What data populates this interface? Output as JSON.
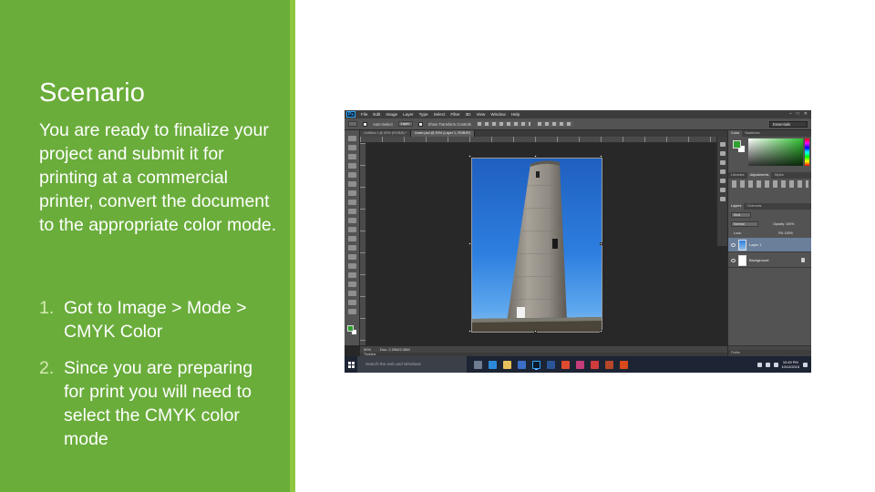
{
  "slide": {
    "title": "Scenario",
    "intro": "You are ready to finalize your project and submit it for printing at a commercial printer, convert the document to the appropriate color mode.",
    "steps": [
      {
        "number": "1.",
        "text": "Got to Image > Mode > CMYK Color"
      },
      {
        "number": "2.",
        "text": "Since you are preparing for print you will need to select the CMYK color mode"
      }
    ]
  },
  "colors": {
    "panel_green": "#6aad3b",
    "panel_edge": "#8dc63f",
    "number_color": "#d4ecb2"
  },
  "photoshop": {
    "logo": "Ps",
    "menus": [
      "File",
      "Edit",
      "Image",
      "Layer",
      "Type",
      "Select",
      "Filter",
      "3D",
      "View",
      "Window",
      "Help"
    ],
    "options": {
      "auto_select": "Auto-Select",
      "auto_select_target": "Layer",
      "show_transform": "Show Transform Controls",
      "workspace": "Essentials"
    },
    "doc_tabs": [
      {
        "label": "Untitled-1 @ 50% (RGB/8) *",
        "active": false
      },
      {
        "label": "tower.psd @ 50% (Layer 1, RGB/8*)",
        "active": true
      }
    ],
    "status": {
      "zoom": "50%",
      "doc_size": "Doc: 2.29M/2.08M"
    },
    "timeline": "Timeline",
    "panels": {
      "color_tabs": [
        "Color",
        "Swatches"
      ],
      "adjust_tabs": [
        "Libraries",
        "Adjustments",
        "Styles"
      ],
      "layers_tabs": [
        "Layers",
        "Channels"
      ],
      "kind": "Kind",
      "blend": "Normal",
      "opacity": "Opacity: 100%",
      "lock": "Lock:",
      "fill": "Fill: 100%",
      "layers": [
        {
          "name": "Layer 1",
          "selected": true
        },
        {
          "name": "Background",
          "selected": false
        }
      ],
      "paths_label": "Paths"
    },
    "taskbar": {
      "search_placeholder": "Search the web and Windows",
      "time": "10:49 PM",
      "date": "10/12/2015"
    }
  }
}
